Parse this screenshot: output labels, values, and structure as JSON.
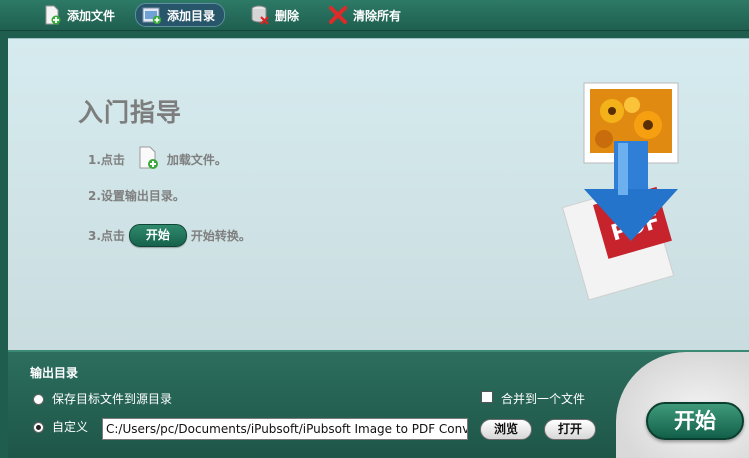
{
  "toolbar": {
    "add_file": "添加文件",
    "add_folder": "添加目录",
    "delete": "删除",
    "clear_all": "清除所有"
  },
  "guide": {
    "title": "入门指导",
    "step1_prefix": "1.点击",
    "step1_suffix": "加载文件。",
    "step2": "2.设置输出目录。",
    "step3_prefix": "3.点击",
    "step3_button": "开始",
    "step3_suffix": "开始转换。"
  },
  "output": {
    "label": "输出目录",
    "option_source": "保存目标文件到源目录",
    "option_custom": "自定义",
    "path_value": "C:/Users/pc/Documents/iPubsoft/iPubsoft Image to PDF Conv",
    "merge_label": "合并到一个文件",
    "browse": "浏览",
    "open": "打开",
    "start": "开始"
  },
  "colors": {
    "accent_green": "#1f5e4f",
    "start_button": "#13604a",
    "guide_text": "#7d7d7d"
  }
}
